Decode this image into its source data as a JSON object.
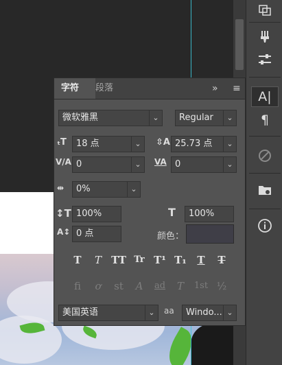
{
  "panel": {
    "tabs": [
      {
        "label": "字符"
      },
      {
        "label": "段落"
      }
    ],
    "tab_expand": "»",
    "tab_menu": "≡",
    "font_family": "微软雅黑",
    "font_style": "Regular",
    "font_size": "18 点",
    "leading": "25.73 点",
    "kerning": "0",
    "tracking": "0",
    "tsume": "0%",
    "vertical_scale": "100%",
    "horizontal_scale": "100%",
    "baseline_shift": "0 点",
    "color_label": "颜色：",
    "color_value": "#3f3e47",
    "language": "美国英语",
    "antialias_label": "aa",
    "antialias": "Windo...",
    "style_buttons": [
      "T",
      "T",
      "TT",
      "Tr",
      "T¹",
      "T₁",
      "T",
      "T"
    ],
    "opentype_buttons": [
      "fi",
      "ơ",
      "st",
      "A",
      "ad",
      "T",
      "1st",
      "½"
    ]
  },
  "dock": {
    "icons": [
      "transform-icon",
      "brushes-icon",
      "adjust-icon",
      "character-icon",
      "paragraph-icon",
      "glyphs-icon",
      "libraries-icon",
      "info-icon"
    ],
    "character_label": "A|",
    "paragraph_label": "¶",
    "info_label": "i"
  }
}
